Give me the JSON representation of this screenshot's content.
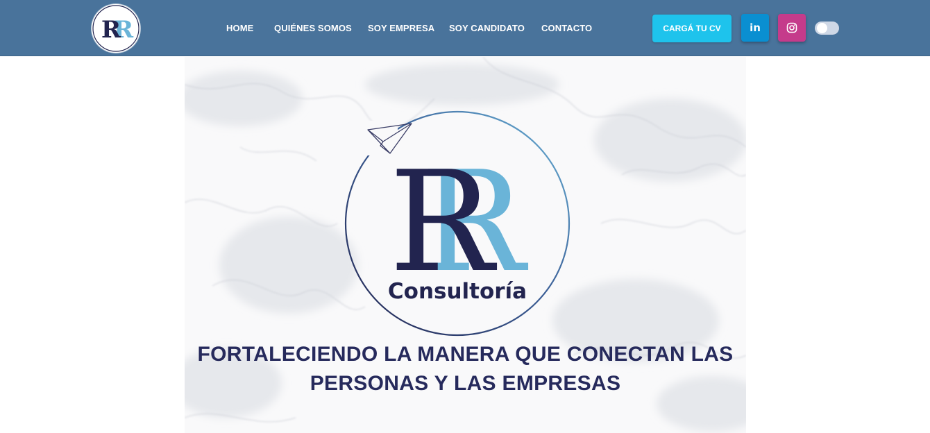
{
  "brand": {
    "logo_letters": "RR",
    "logo_text": "Consultoría",
    "colors": {
      "navy": "#22244f",
      "light_blue": "#6ab4d8"
    }
  },
  "navbar": {
    "background": "#49739b",
    "links": [
      {
        "label": "HOME"
      },
      {
        "label": "QUIÉNES SOMOS"
      },
      {
        "label": "SOY EMPRESA"
      },
      {
        "label": "SOY CANDIDATO"
      },
      {
        "label": "CONTACTO"
      }
    ],
    "cta_label": "CARGÁ TU CV",
    "cta_color": "#1ec3ec",
    "social": {
      "linkedin": {
        "icon": "linkedin-icon",
        "text": "in",
        "color": "#0a8fd1"
      },
      "instagram": {
        "icon": "instagram-icon",
        "color": "#c53b8b"
      }
    },
    "theme_toggle": {
      "state": "off"
    }
  },
  "hero": {
    "tagline_line1": "FORTALECIENDO LA MANERA QUE CONECTAN LAS",
    "tagline_line2": "PERSONAS Y LAS EMPRESAS",
    "tagline_color": "#262a5c"
  }
}
